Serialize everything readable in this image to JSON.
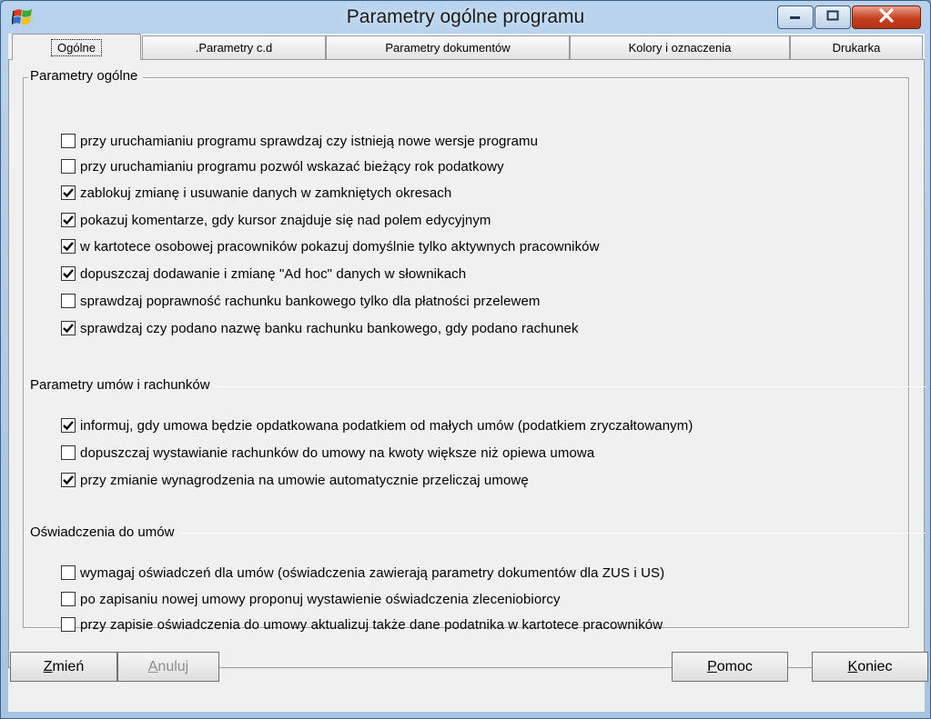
{
  "window": {
    "title": "Parametry ogólne programu",
    "colors": {
      "frame": "#b9d3ee",
      "close": "#c6401f",
      "panel": "#f0f0f0"
    }
  },
  "tabs": [
    {
      "label": "Ogólne",
      "active": true
    },
    {
      "label": ".Parametry c.d",
      "active": false
    },
    {
      "label": "Parametry dokumentów",
      "active": false
    },
    {
      "label": "Kolory i oznaczenia",
      "active": false
    },
    {
      "label": "Drukarka",
      "active": false
    }
  ],
  "groups": [
    {
      "title": "Parametry ogólne",
      "options": [
        {
          "label": "przy uruchamianiu programu sprawdzaj czy istnieją nowe wersje programu",
          "checked": false
        },
        {
          "label": "przy uruchamianiu programu pozwól wskazać bieżący rok podatkowy",
          "checked": false
        },
        {
          "label": "zablokuj zmianę i usuwanie danych w zamkniętych okresach",
          "checked": true
        },
        {
          "label": "pokazuj komentarze, gdy kursor znajduje się nad polem edycyjnym",
          "checked": true
        },
        {
          "label": "w kartotece osobowej pracowników pokazuj domyślnie tylko aktywnych pracowników",
          "checked": true
        },
        {
          "label": "dopuszczaj dodawanie i zmianę \"Ad hoc\" danych w słownikach",
          "checked": true
        },
        {
          "label": "sprawdzaj poprawność rachunku bankowego tylko dla płatności przelewem",
          "checked": false
        },
        {
          "label": "sprawdzaj czy podano nazwę banku rachunku bankowego, gdy podano rachunek",
          "checked": true
        }
      ]
    },
    {
      "title": "Parametry umów i rachunków",
      "options": [
        {
          "label": "informuj, gdy umowa będzie opdatkowana podatkiem od małych umów (podatkiem zryczałtowanym)",
          "checked": true
        },
        {
          "label": "dopuszczaj wystawianie rachunków do umowy na kwoty większe niż opiewa umowa",
          "checked": false
        },
        {
          "label": "przy zmianie wynagrodzenia na umowie automatycznie przeliczaj umowę",
          "checked": true
        }
      ]
    },
    {
      "title": "Oświadczenia do umów",
      "options": [
        {
          "label": "wymagaj oświadczeń dla umów (oświadczenia zawierają parametry dokumentów dla ZUS i US)",
          "checked": false
        },
        {
          "label": "po zapisaniu nowej umowy proponuj wystawienie oświadczenia zleceniobiorcy",
          "checked": false
        },
        {
          "label": "przy zapisie oświadczenia do umowy aktualizuj także dane podatnika w kartotece pracowników",
          "checked": false
        }
      ]
    }
  ],
  "buttons": {
    "change": {
      "first": "Z",
      "rest": "mień",
      "enabled": true
    },
    "cancel": {
      "first": "A",
      "rest": "nuluj",
      "enabled": false
    },
    "help": {
      "first": "P",
      "rest": "omoc",
      "enabled": true
    },
    "close": {
      "first": "K",
      "rest": "oniec",
      "enabled": true
    }
  },
  "icons": {
    "app": "windows-flag-icon",
    "minimize": "minimize-icon",
    "maximize": "maximize-icon",
    "close": "close-icon",
    "check": "checkmark-icon"
  }
}
